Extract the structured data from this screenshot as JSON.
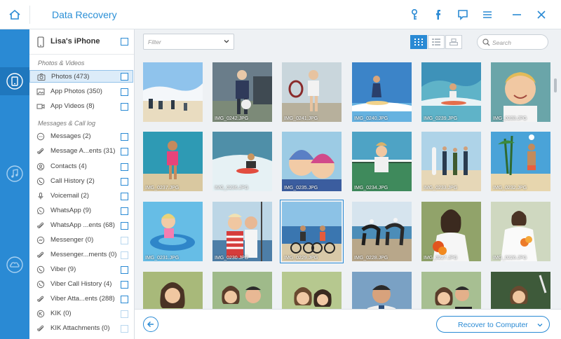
{
  "app": {
    "title": "Data Recovery",
    "accent": "#2a8ad4"
  },
  "titlebar_icons": [
    "home-icon",
    "key-icon",
    "facebook-icon",
    "feedback-icon",
    "menu-icon",
    "minimize-icon",
    "close-icon"
  ],
  "rail": {
    "items": [
      "ios-device-icon",
      "itunes-backup-icon",
      "icloud-backup-icon"
    ],
    "active": 0
  },
  "sidebar": {
    "device": "Lisa's iPhone",
    "categories": {
      "photos": "Photos & Videos",
      "messages": "Messages & Call log"
    },
    "items": [
      {
        "label": "Photos (473)",
        "icon": "camera-icon",
        "selected": true
      },
      {
        "label": "App Photos (350)",
        "icon": "image-icon"
      },
      {
        "label": "App Videos (8)",
        "icon": "video-icon"
      },
      {
        "label": "Messages (2)",
        "icon": "message-icon"
      },
      {
        "label": "Message A...ents (31)",
        "icon": "paperclip-icon"
      },
      {
        "label": "Contacts (4)",
        "icon": "contact-icon"
      },
      {
        "label": "Call History (2)",
        "icon": "phone-icon"
      },
      {
        "label": "Voicemail (2)",
        "icon": "microphone-icon"
      },
      {
        "label": "WhatsApp (9)",
        "icon": "whatsapp-icon"
      },
      {
        "label": "WhatsApp ...ents (68)",
        "icon": "paperclip-icon"
      },
      {
        "label": "Messenger (0)",
        "icon": "messenger-icon",
        "dim": true
      },
      {
        "label": "Messenger...ments (0)",
        "icon": "paperclip-icon",
        "dim": true
      },
      {
        "label": "Viber (9)",
        "icon": "viber-icon"
      },
      {
        "label": "Viber Call History (4)",
        "icon": "viber-call-icon"
      },
      {
        "label": "Viber Atta...ents (288)",
        "icon": "paperclip-icon"
      },
      {
        "label": "KIK (0)",
        "icon": "kik-icon",
        "dim": true
      },
      {
        "label": "KIK Attachments (0)",
        "icon": "paperclip-icon",
        "dim": true
      }
    ]
  },
  "toolbar": {
    "filter_placeholder": "Filter",
    "search_placeholder": "Search",
    "view_modes": [
      "grid-view-icon",
      "list-view-icon",
      "detail-view-icon"
    ],
    "active_view": 0
  },
  "photos": [
    {
      "caption": "",
      "scene": "beach"
    },
    {
      "caption": "IMG_0242.JPG",
      "scene": "soccer"
    },
    {
      "caption": "IMG_0241.JPG",
      "scene": "tennis"
    },
    {
      "caption": "IMG_0240.JPG",
      "scene": "surf"
    },
    {
      "caption": "IMG_0239.JPG",
      "scene": "surf2"
    },
    {
      "caption": "IMG_0238.JPG",
      "scene": "boy"
    },
    {
      "caption": "IMG_0237.JPG",
      "scene": "girlbeach"
    },
    {
      "caption": "IMG_0236.JPG",
      "scene": "bodyboard"
    },
    {
      "caption": "IMG_0235.JPG",
      "scene": "kids"
    },
    {
      "caption": "IMG_0234.JPG",
      "scene": "tennisgirl"
    },
    {
      "caption": "IMG_0233.JPG",
      "scene": "surfers"
    },
    {
      "caption": "IMG_0232.JPG",
      "scene": "volley"
    },
    {
      "caption": "IMG_0231.JPG",
      "scene": "pool"
    },
    {
      "caption": "IMG_0230.JPG",
      "scene": "couple"
    },
    {
      "caption": "IMG_0229.JPG",
      "scene": "bikes",
      "selected": true
    },
    {
      "caption": "IMG_0228.JPG",
      "scene": "horses"
    },
    {
      "caption": "IMG_0227.JPG",
      "scene": "bride"
    },
    {
      "caption": "IMG_0226.JPG",
      "scene": "bride2"
    },
    {
      "caption": "",
      "scene": "woman"
    },
    {
      "caption": "",
      "scene": "family"
    },
    {
      "caption": "",
      "scene": "women"
    },
    {
      "caption": "",
      "scene": "man"
    },
    {
      "caption": "",
      "scene": "wedding"
    },
    {
      "caption": "",
      "scene": "couple2"
    }
  ],
  "bottom": {
    "recover_label": "Recover to Computer",
    "back_icon": "back-arrow-icon"
  }
}
